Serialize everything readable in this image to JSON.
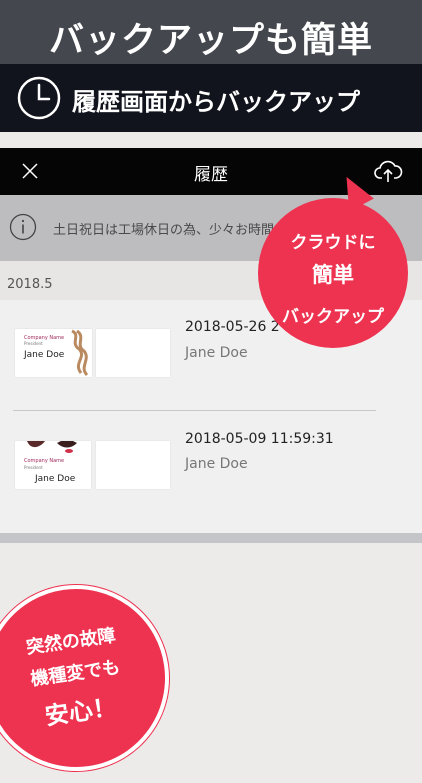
{
  "hero": {
    "title": "バックアップも簡単",
    "subtitle": "履歴画面からバックアップ"
  },
  "navbar": {
    "title": "履歴",
    "close_icon": "close-icon",
    "upload_icon": "cloud-upload-icon"
  },
  "notice": {
    "icon": "info-icon",
    "text": "土日祝日は工場休日の為、少々お時間か"
  },
  "section": {
    "label": "2018.5"
  },
  "history": [
    {
      "datetime": "2018-05-26 2",
      "name": "Jane Doe",
      "card": {
        "company": "Company Name",
        "title": "President",
        "name": "Jane Doe"
      }
    },
    {
      "datetime": "2018-05-09 11:59:31",
      "name": "Jane Doe",
      "card": {
        "company": "Company Name",
        "title": "President",
        "name": "Jane Doe"
      }
    }
  ],
  "badge_cloud": {
    "line1": "クラウドに",
    "line2": "簡単",
    "line3": "バックアップ"
  },
  "badge_safe": {
    "line1": "突然の故障",
    "line2": "機種変でも",
    "line3": "安心！"
  },
  "colors": {
    "accent": "#ee3350",
    "navbar": "#050505",
    "hero": "#44474d"
  }
}
